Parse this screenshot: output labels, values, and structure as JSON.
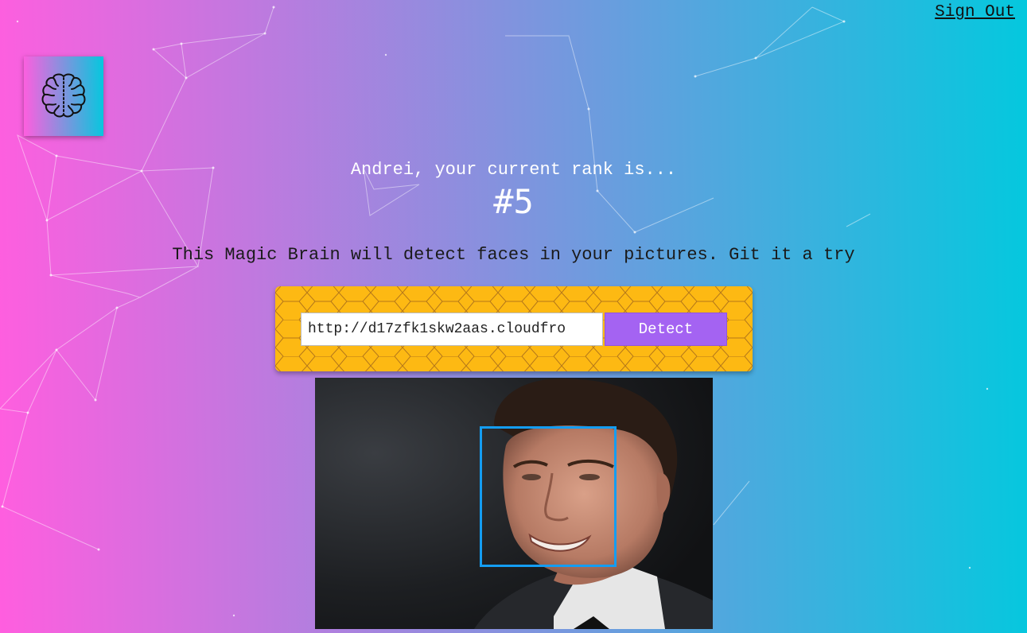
{
  "nav": {
    "signout_label": "Sign Out"
  },
  "logo": {
    "icon": "brain-icon"
  },
  "rank": {
    "intro": "Andrei, your current rank is...",
    "value": "#5"
  },
  "tagline": "This Magic Brain will detect faces in your pictures. Git it a try",
  "form": {
    "input_value": "http://d17zfk1skw2aas.cloudfro",
    "button_label": "Detect"
  },
  "colors": {
    "gradient_start": "#ff5edf",
    "gradient_end": "#04c8de",
    "button": "#a463f2",
    "pattern_bg": "#fdb913",
    "face_box": "#149df2"
  }
}
